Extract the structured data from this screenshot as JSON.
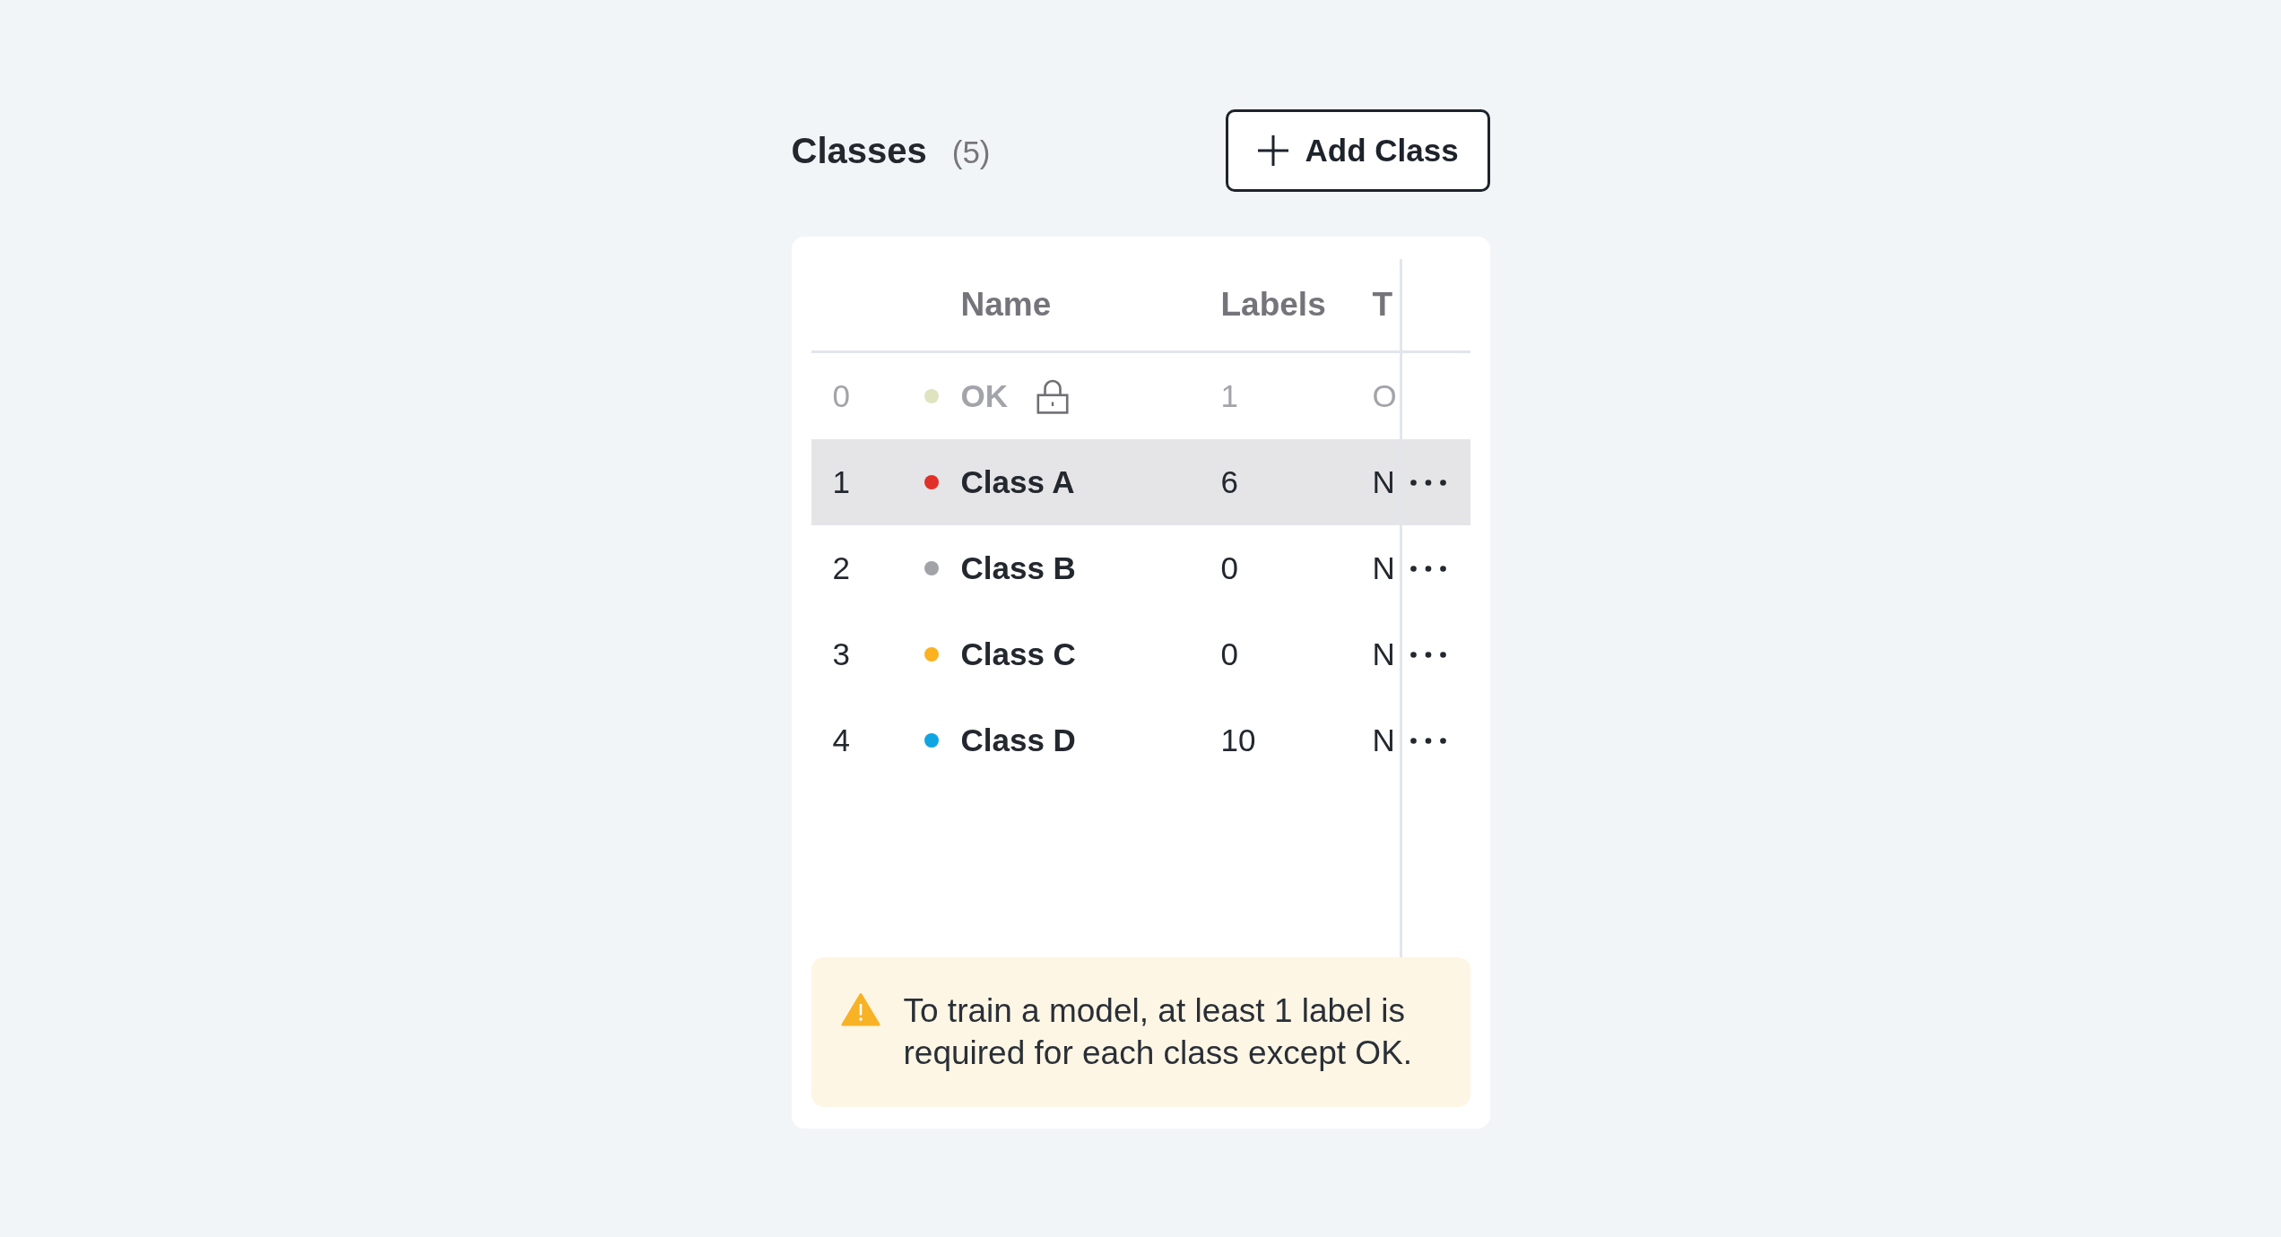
{
  "header": {
    "title": "Classes",
    "count": "(5)",
    "add_button": "Add Class"
  },
  "table": {
    "columns": {
      "name": "Name",
      "labels": "Labels",
      "column_4": "T"
    },
    "rows": [
      {
        "index": "0",
        "name": "OK",
        "color": "#dfe3c0",
        "labels": "1",
        "column_4": "O",
        "locked": true,
        "selected": false
      },
      {
        "index": "1",
        "name": "Class A",
        "color": "#e0302a",
        "labels": "6",
        "column_4": "N",
        "locked": false,
        "selected": true
      },
      {
        "index": "2",
        "name": "Class B",
        "color": "#a2a2a9",
        "labels": "0",
        "column_4": "N",
        "locked": false,
        "selected": false
      },
      {
        "index": "3",
        "name": "Class C",
        "color": "#fbb220",
        "labels": "0",
        "column_4": "N",
        "locked": false,
        "selected": false
      },
      {
        "index": "4",
        "name": "Class D",
        "color": "#0ea5e2",
        "labels": "10",
        "column_4": "N",
        "locked": false,
        "selected": false
      }
    ]
  },
  "warning": {
    "message": "To train a model, at least 1 label is required for each class except OK."
  }
}
